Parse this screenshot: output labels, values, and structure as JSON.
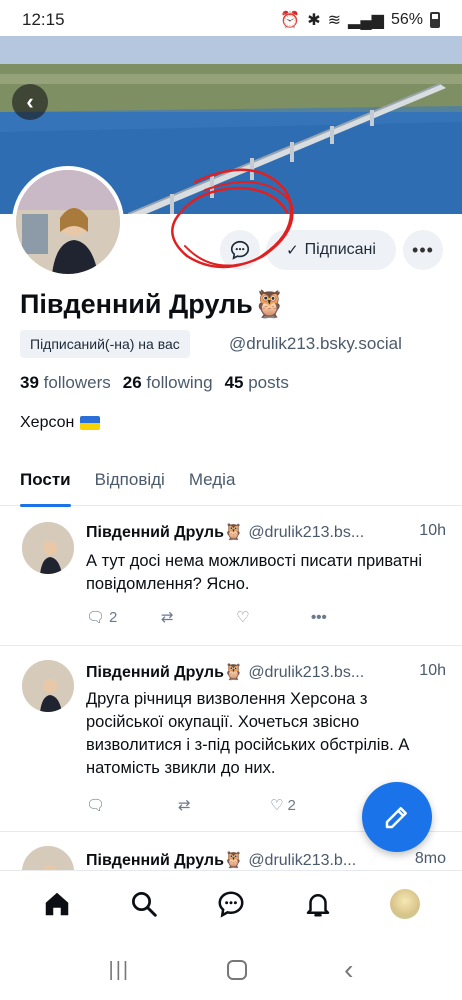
{
  "status_bar": {
    "time": "12:15",
    "battery": "56%"
  },
  "profile": {
    "display_name": "Південний Друль🦉",
    "follows_you_badge": "Підписаний(-на) на вас",
    "handle": "@drulik213.bsky.social",
    "followers_count": "39",
    "followers_label": "followers",
    "following_count": "26",
    "following_label": "following",
    "posts_count": "45",
    "posts_label": "posts",
    "bio": "Херсон"
  },
  "actions": {
    "subscribed_label": "Підписані",
    "more_label": "•••"
  },
  "tabs": [
    {
      "label": "Пости",
      "active": true
    },
    {
      "label": "Відповіді",
      "active": false
    },
    {
      "label": "Медіа",
      "active": false
    }
  ],
  "posts": [
    {
      "author": "Південний Друль🦉",
      "handle": "@drulik213.bs...",
      "time": "10h",
      "text": "А тут досі нема можливості писати приватні повідомлення? Ясно.",
      "replies": "2",
      "reposts": "",
      "likes": ""
    },
    {
      "author": "Південний Друль🦉",
      "handle": "@drulik213.bs...",
      "time": "10h",
      "text": "Друга річниця визволення Херсона з російської окупації. Хочеться звісно визволитися і з-під російських обстрілів. А натомість звикли до них.",
      "replies": "",
      "reposts": "",
      "likes": "2"
    },
    {
      "author": "Південний Друль🦉",
      "handle": "@drulik213.b...",
      "time": "8mo",
      "text": "",
      "replies": "",
      "reposts": "",
      "likes": ""
    }
  ],
  "colors": {
    "accent": "#1a73e8",
    "muted": "#4b5a6c",
    "annotation": "#e02020"
  }
}
